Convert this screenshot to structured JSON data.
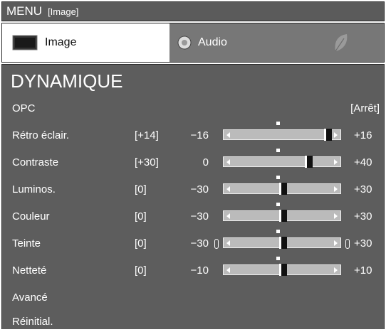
{
  "titlebar": {
    "menu": "MENU",
    "section": "[Image]"
  },
  "tabs": [
    {
      "label": "Image",
      "icon": "tv-icon",
      "active": true
    },
    {
      "label": "Audio",
      "icon": "speaker-icon",
      "active": false
    },
    {
      "label": "",
      "icon": "leaf-icon",
      "active": false
    }
  ],
  "panel": {
    "title": "DYNAMIQUE",
    "opc": {
      "label": "OPC",
      "value": "[Arrêt]"
    },
    "sliders": [
      {
        "label": "Rétro éclair.",
        "value": "[+14]",
        "min": "−16",
        "max": "+16",
        "level": 14,
        "range": [
          -16,
          16
        ]
      },
      {
        "label": "Contraste",
        "value": "[+30]",
        "min": "0",
        "max": "+40",
        "level": 30,
        "range": [
          0,
          40
        ]
      },
      {
        "label": "Luminos.",
        "value": "[0]",
        "min": "−30",
        "max": "+30",
        "level": 0,
        "range": [
          -30,
          30
        ]
      },
      {
        "label": "Couleur",
        "value": "[0]",
        "min": "−30",
        "max": "+30",
        "level": 0,
        "range": [
          -30,
          30
        ]
      },
      {
        "label": "Teinte",
        "value": "[0]",
        "min": "−30",
        "max": "+30",
        "level": 0,
        "range": [
          -30,
          30
        ]
      },
      {
        "label": "Netteté",
        "value": "[0]",
        "min": "−10",
        "max": "+10",
        "level": 0,
        "range": [
          -10,
          10
        ]
      }
    ],
    "advanced": "Avancé",
    "reset": "Réinitial."
  }
}
